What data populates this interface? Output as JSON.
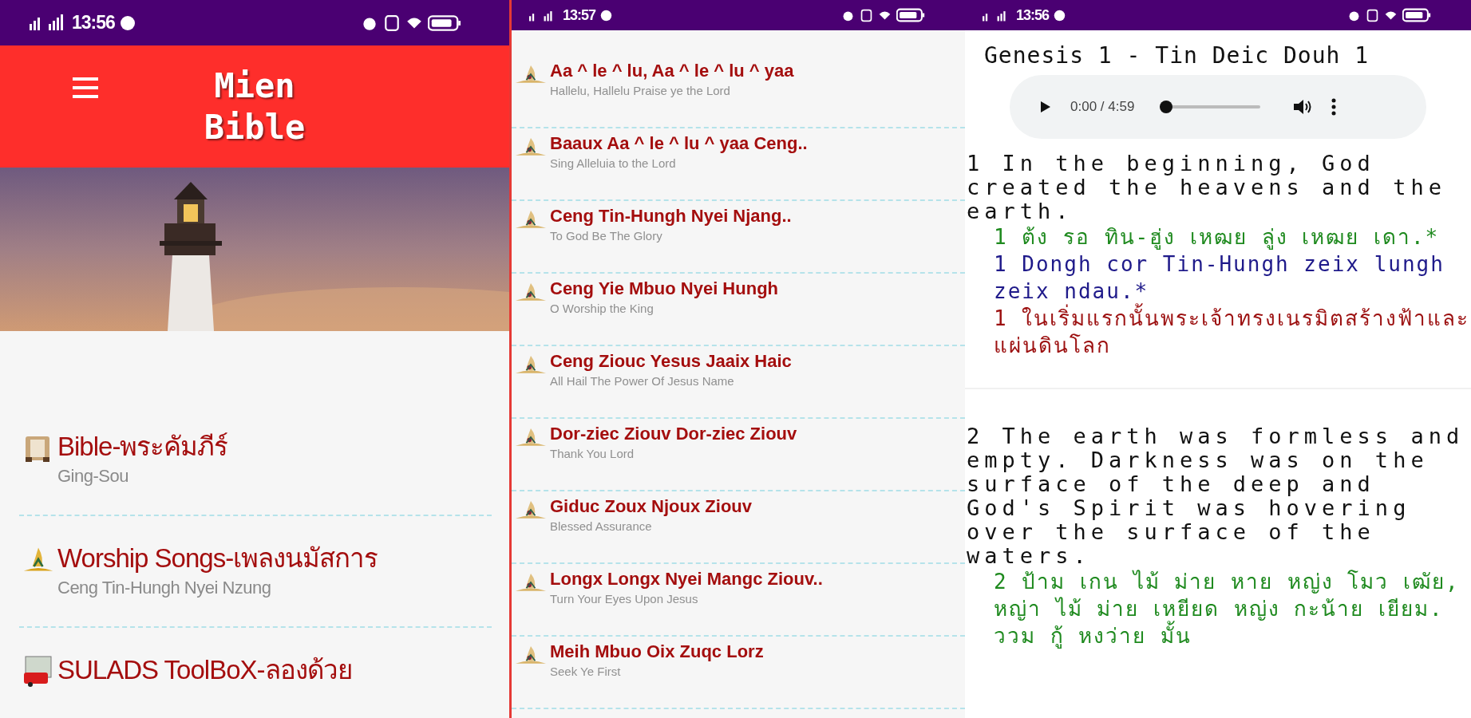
{
  "home_screen": {
    "status_bar": {
      "time": "13:56"
    },
    "app_bar": {
      "title": "Mien Bible"
    },
    "menu": [
      {
        "kind": "bible",
        "title": "Bible-พระคัมภีร์",
        "subtitle": "Ging-Sou"
      },
      {
        "kind": "songs",
        "title": "Worship Songs-เพลงนมัสการ",
        "subtitle": "Ceng Tin-Hungh Nyei Nzung"
      },
      {
        "kind": "toolbox",
        "title": "SULADS ToolBoX-ลองด้วย"
      }
    ]
  },
  "songs_screen": {
    "status_bar": {
      "time": "13:57"
    },
    "songs": [
      {
        "title": "Aa ^ le ^ lu, Aa ^ le ^ lu ^ yaa",
        "subtitle": "Hallelu, Hallelu Praise ye the Lord"
      },
      {
        "title": "Baaux Aa ^ le ^ lu ^ yaa Ceng..",
        "subtitle": "Sing Alleluia to the Lord"
      },
      {
        "title": "Ceng Tin-Hungh Nyei Njang..",
        "subtitle": "To God Be The Glory"
      },
      {
        "title": "Ceng Yie Mbuo Nyei Hungh",
        "subtitle": "O Worship the King"
      },
      {
        "title": "Ceng Ziouc Yesus Jaaix Haic",
        "subtitle": "All Hail The Power Of Jesus Name"
      },
      {
        "title": "Dor-ziec Ziouv Dor-ziec Ziouv",
        "subtitle": "Thank You Lord"
      },
      {
        "title": "Giduc Zoux Njoux Ziouv",
        "subtitle": "Blessed Assurance"
      },
      {
        "title": "Longx Longx Nyei Mangc Ziouv..",
        "subtitle": "Turn Your Eyes Upon Jesus"
      },
      {
        "title": "Meih Mbuo Oix Zuqc Lorz",
        "subtitle": "Seek Ye First"
      }
    ]
  },
  "chapter_screen": {
    "status_bar": {
      "time": "13:56"
    },
    "heading": "Genesis 1 - Tin Deic Douh 1",
    "audio_player": {
      "time": "0:00 / 4:59",
      "level": 0
    },
    "verses": [
      {
        "text": "1 In the beginning, God created the heavens and the earth.",
        "translations": [
          {
            "kind": "mien_thai",
            "text": "1 ต้ง รอ ทิน-ฮู่ง เหฒย ลู่ง เหฒย เดา.*"
          },
          {
            "kind": "mien",
            "text": "1 Dongh cor Tin-Hungh zeix lungh zeix ndau.*"
          },
          {
            "kind": "thai",
            "text": "1 ในเริ่มแรกนั้นพระเจ้าทรงเนรมิตสร้างฟ้าและแผ่นดินโลก"
          }
        ]
      },
      {
        "text": "2 The earth was formless and empty. Darkness was on the surface of the deep and God's Spirit was hovering over the surface of the waters.",
        "translations": [
          {
            "kind": "mien_thai",
            "text": "2 ป้าม เกน ไม้ ม่าย หาย หญ่ง โมว เฒัย, หญ่า ไม้ ม่าย เหยียด หญ่ง กะน้าย เยียม. ววม กู้ หงว่าย มั้น"
          }
        ]
      }
    ]
  }
}
